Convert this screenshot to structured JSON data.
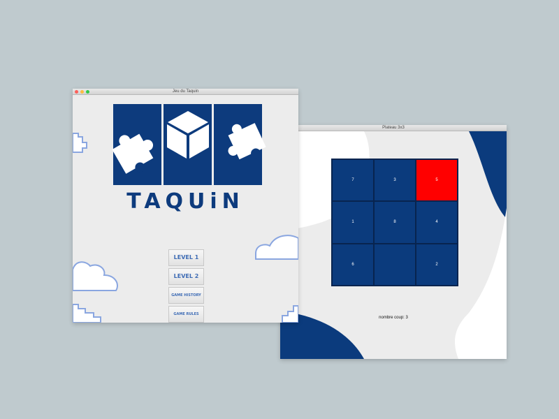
{
  "board_window": {
    "title": "Plateau 3x3",
    "tiles": [
      "7",
      "3",
      "5",
      "1",
      "8",
      "4",
      "6",
      "",
      "2"
    ],
    "highlight_color": "#ff0000",
    "tile_color": "#0b3b7d",
    "move_count_label": "nombre coup: 3"
  },
  "menu_window": {
    "title": "Jeu du Taquin",
    "logo_text": "TAQUiN",
    "buttons": {
      "level1": "LEVEL 1",
      "level2": "LEVEL 2",
      "history": "GAME HISTORY",
      "rules": "GAME RULES"
    }
  }
}
